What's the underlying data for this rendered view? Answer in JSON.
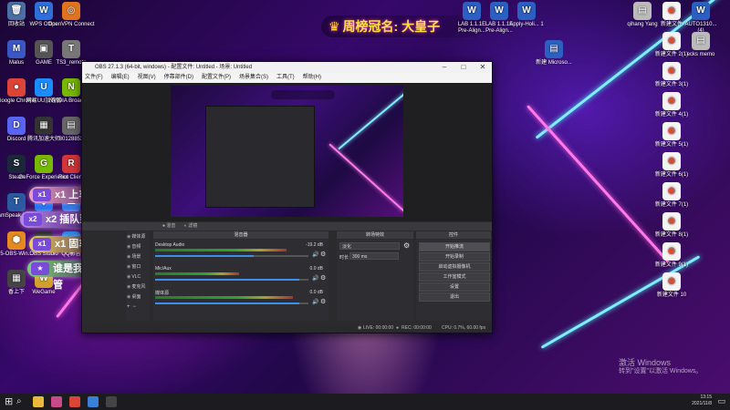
{
  "desktop": {
    "left_icons": [
      {
        "label": "回收站",
        "glyph": "🗑",
        "color": "#4a6fa5"
      },
      {
        "label": "WPS Office",
        "glyph": "W",
        "color": "#2f6fd8"
      },
      {
        "label": "OpenVPN Connect",
        "glyph": "◎",
        "color": "#e0731f"
      },
      {
        "label": "Malus",
        "glyph": "M",
        "color": "#3b57c4"
      },
      {
        "label": "GAME",
        "glyph": "▣",
        "color": "#555"
      },
      {
        "label": "TS3_remote",
        "glyph": "T",
        "color": "#777"
      },
      {
        "label": "Google Chrome",
        "glyph": "●",
        "color": "#db4437"
      },
      {
        "label": "网易UU加速器",
        "glyph": "U",
        "color": "#1b8cff"
      },
      {
        "label": "NVIDIA Broadcast",
        "glyph": "N",
        "color": "#76b900"
      },
      {
        "label": "Discord",
        "glyph": "D",
        "color": "#5865f2"
      },
      {
        "label": "腾讯加速大师",
        "glyph": "▦",
        "color": "#333"
      },
      {
        "label": "80128853",
        "glyph": "▤",
        "color": "#666"
      },
      {
        "label": "Steam",
        "glyph": "S",
        "color": "#1b2838"
      },
      {
        "label": "GeForce Experience",
        "glyph": "G",
        "color": "#76b900"
      },
      {
        "label": "Riot Client",
        "glyph": "R",
        "color": "#d13639"
      },
      {
        "label": "TeamSpeak 3 Client",
        "glyph": "T",
        "color": "#2a5aa0"
      },
      {
        "label": "腾讯会议",
        "glyph": "◆",
        "color": "#1c6cf2"
      },
      {
        "label": "百度网盘",
        "glyph": "☁",
        "color": "#2a6fe8"
      },
      {
        "label": "5-OBS-Win...",
        "glyph": "⬢",
        "color": "#e58a1f"
      },
      {
        "label": "OBS Studio",
        "glyph": "◉",
        "color": "#222"
      },
      {
        "label": "QQ影音",
        "glyph": "Q",
        "color": "#1e7be3"
      },
      {
        "label": "香上下",
        "glyph": "▦",
        "color": "#444"
      },
      {
        "label": "WeGame",
        "glyph": "W",
        "color": "#d0a02a"
      }
    ],
    "top_files": [
      {
        "label": "LAB 1.1.1E Pre-Align...",
        "glyph": "W"
      },
      {
        "label": "LAB 1.1.1E Pre-Align...",
        "glyph": "W"
      },
      {
        "label": "Apply-Holi... 1",
        "glyph": "W"
      },
      {
        "label": "新建 Microso...",
        "glyph": "▤"
      }
    ],
    "right_icons": [
      {
        "label": "qihang Yang",
        "glyph": "▤"
      },
      {
        "label": "新建文件",
        "glyph": "◉"
      },
      {
        "label": "AUTO1310... (4)",
        "glyph": "W"
      },
      {
        "label": "新建文件 2(1)",
        "glyph": "◉"
      },
      {
        "label": "ecks memo",
        "glyph": "▤"
      },
      {
        "label": "新建文件 3(1)",
        "glyph": "◉"
      },
      {
        "label": "新建文件 4(1)",
        "glyph": "◉"
      },
      {
        "label": "新建文件 5(1)",
        "glyph": "◉"
      },
      {
        "label": "新建文件 6(1)",
        "glyph": "◉"
      },
      {
        "label": "新建文件 7(1)",
        "glyph": "◉"
      },
      {
        "label": "新建文件 8(1)",
        "glyph": "◉"
      },
      {
        "label": "新建文件 9(1)",
        "glyph": "◉"
      },
      {
        "label": "新建文件 10",
        "glyph": "◉"
      }
    ],
    "banner_text": "周榜冠名: 大皇子",
    "pills": [
      {
        "badge": "x1",
        "text": "x1 上车",
        "color": "#f2a0c8"
      },
      {
        "badge": "x2",
        "text": "x2 插队到下播",
        "color": "#b888f2"
      },
      {
        "badge": "x1",
        "text": "x1 固车位",
        "color": "#f0d060"
      },
      {
        "badge": "★",
        "text": "谁是我大哥+房管",
        "color": "#7fd07f"
      }
    ],
    "watermark_line1": "激活 Windows",
    "watermark_line2": "转到\"设置\"以激活 Windows。"
  },
  "obs": {
    "title": "OBS 27.1.3 (64-bit, windows) - 配置文件: Untitled - 场景: Untitled",
    "menu": [
      "文件(F)",
      "编辑(E)",
      "视图(V)",
      "停靠部件(D)",
      "配置文件(P)",
      "场景集合(S)",
      "工具(T)",
      "帮助(H)"
    ],
    "scene_bar": [
      "● 混音",
      "◐ 滤镜"
    ],
    "docks": {
      "mixer_title": "混音器",
      "transitions_title": "转场特效",
      "controls_title": "控件"
    },
    "mixer": [
      {
        "name": "Desktop Audio",
        "db": "-19.2 dB",
        "level": 0.86,
        "volume": 0.64
      },
      {
        "name": "Mic/Aux",
        "db": "0.0 dB",
        "level": 0.55,
        "volume": 0.94
      },
      {
        "name": "媒体源",
        "db": "0.0 dB",
        "level": 0.9,
        "volume": 0.94
      }
    ],
    "sources": [
      "媒体源",
      "音频",
      "场景",
      "窗口",
      "VLC",
      "麦克风",
      "桌面"
    ],
    "transitions": {
      "type": "淡化",
      "duration_label": "时长",
      "duration_value": "300 ms"
    },
    "controls": [
      "开始推流",
      "开始录制",
      "启动虚拟摄像机",
      "工作室模式",
      "设置",
      "退出"
    ],
    "status": {
      "live": "LIVE: 00:00:00",
      "rec": "REC: 00:00:00",
      "cpu": "CPU: 0.7%, 60.00 fps"
    },
    "scenes_buttons": [
      "场景",
      "来源"
    ]
  },
  "taskbar": {
    "time": "13:15",
    "date": "2021/11/8",
    "apps": [
      {
        "name": "file-explorer",
        "color": "#e8b93a"
      },
      {
        "name": "app",
        "color": "#c94a8a"
      },
      {
        "name": "chrome",
        "color": "#db4437"
      },
      {
        "name": "app2",
        "color": "#3a7fd8"
      },
      {
        "name": "obs",
        "color": "#444"
      }
    ]
  }
}
